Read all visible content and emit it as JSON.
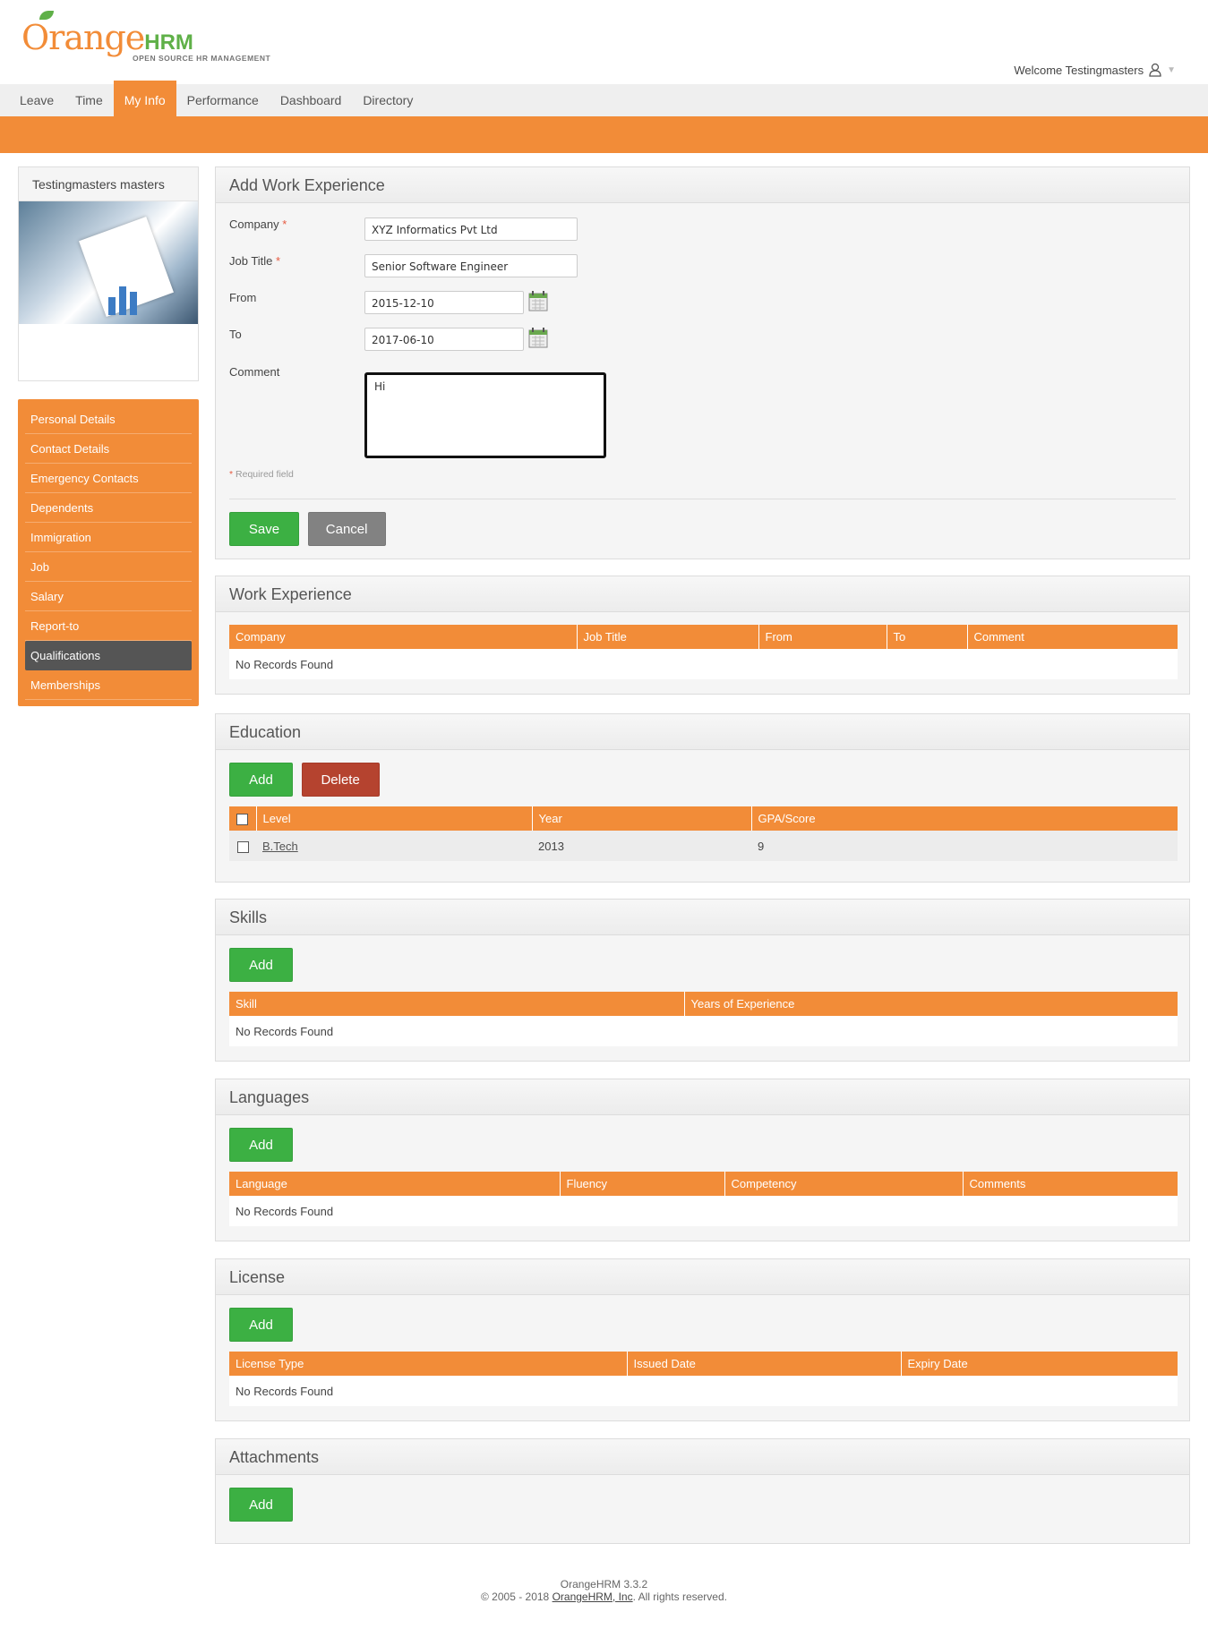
{
  "app": {
    "logo_text_a": "Orange",
    "logo_text_b": "HRM",
    "logo_tagline": "OPEN SOURCE HR MANAGEMENT",
    "welcome": "Welcome Testingmasters"
  },
  "nav": [
    "Leave",
    "Time",
    "My Info",
    "Performance",
    "Dashboard",
    "Directory"
  ],
  "nav_active": "My Info",
  "profile": {
    "name": "Testingmasters masters"
  },
  "sidemenu": [
    "Personal Details",
    "Contact Details",
    "Emergency Contacts",
    "Dependents",
    "Immigration",
    "Job",
    "Salary",
    "Report-to",
    "Qualifications",
    "Memberships"
  ],
  "sidemenu_active": "Qualifications",
  "add_work": {
    "title": "Add Work Experience",
    "labels": {
      "company": "Company",
      "job_title": "Job Title",
      "from": "From",
      "to": "To",
      "comment": "Comment"
    },
    "values": {
      "company": "XYZ Informatics Pvt Ltd",
      "job_title": "Senior Software Engineer",
      "from": "2015-12-10",
      "to": "2017-06-10",
      "comment": "Hi"
    },
    "required_note": "Required field",
    "save": "Save",
    "cancel": "Cancel"
  },
  "work_experience": {
    "title": "Work Experience",
    "columns": [
      "Company",
      "Job Title",
      "From",
      "To",
      "Comment"
    ],
    "empty": "No Records Found"
  },
  "education": {
    "title": "Education",
    "add": "Add",
    "delete": "Delete",
    "columns": [
      "Level",
      "Year",
      "GPA/Score"
    ],
    "rows": [
      {
        "level": "B.Tech",
        "year": "2013",
        "score": "9"
      }
    ]
  },
  "skills": {
    "title": "Skills",
    "add": "Add",
    "columns": [
      "Skill",
      "Years of Experience"
    ],
    "empty": "No Records Found"
  },
  "languages": {
    "title": "Languages",
    "add": "Add",
    "columns": [
      "Language",
      "Fluency",
      "Competency",
      "Comments"
    ],
    "empty": "No Records Found"
  },
  "license": {
    "title": "License",
    "add": "Add",
    "columns": [
      "License Type",
      "Issued Date",
      "Expiry Date"
    ],
    "empty": "No Records Found"
  },
  "attachments": {
    "title": "Attachments",
    "add": "Add"
  },
  "footer": {
    "version": "OrangeHRM 3.3.2",
    "copyright_prefix": "© 2005 - 2018",
    "company_link": "OrangeHRM, Inc",
    "copyright_suffix": ". All rights reserved."
  },
  "colors": {
    "brand_orange": "#f28c38",
    "green": "#3cb043",
    "red": "#b5432f",
    "grey": "#828282"
  }
}
